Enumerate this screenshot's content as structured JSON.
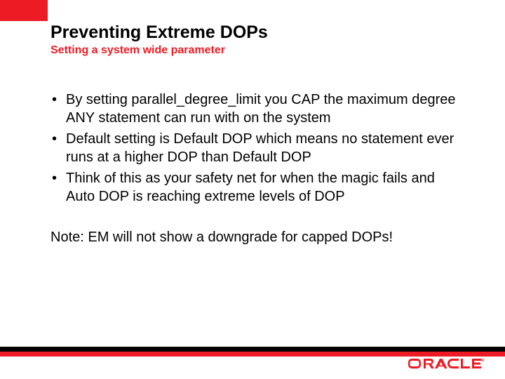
{
  "title": "Preventing Extreme DOPs",
  "subtitle": "Setting a system wide parameter",
  "bullets": [
    "By setting parallel_degree_limit you CAP the maximum degree ANY statement can run with on the system",
    "Default setting is Default DOP which means no statement ever runs at a higher DOP than Default DOP",
    "Think of this as your safety net for when the magic fails and Auto DOP is reaching extreme levels of DOP"
  ],
  "note": "Note: EM will not show a downgrade for capped DOPs!",
  "brand": {
    "logo_name": "ORACLE",
    "logo_color": "#ed1c24",
    "accent_color": "#ed1c24"
  }
}
